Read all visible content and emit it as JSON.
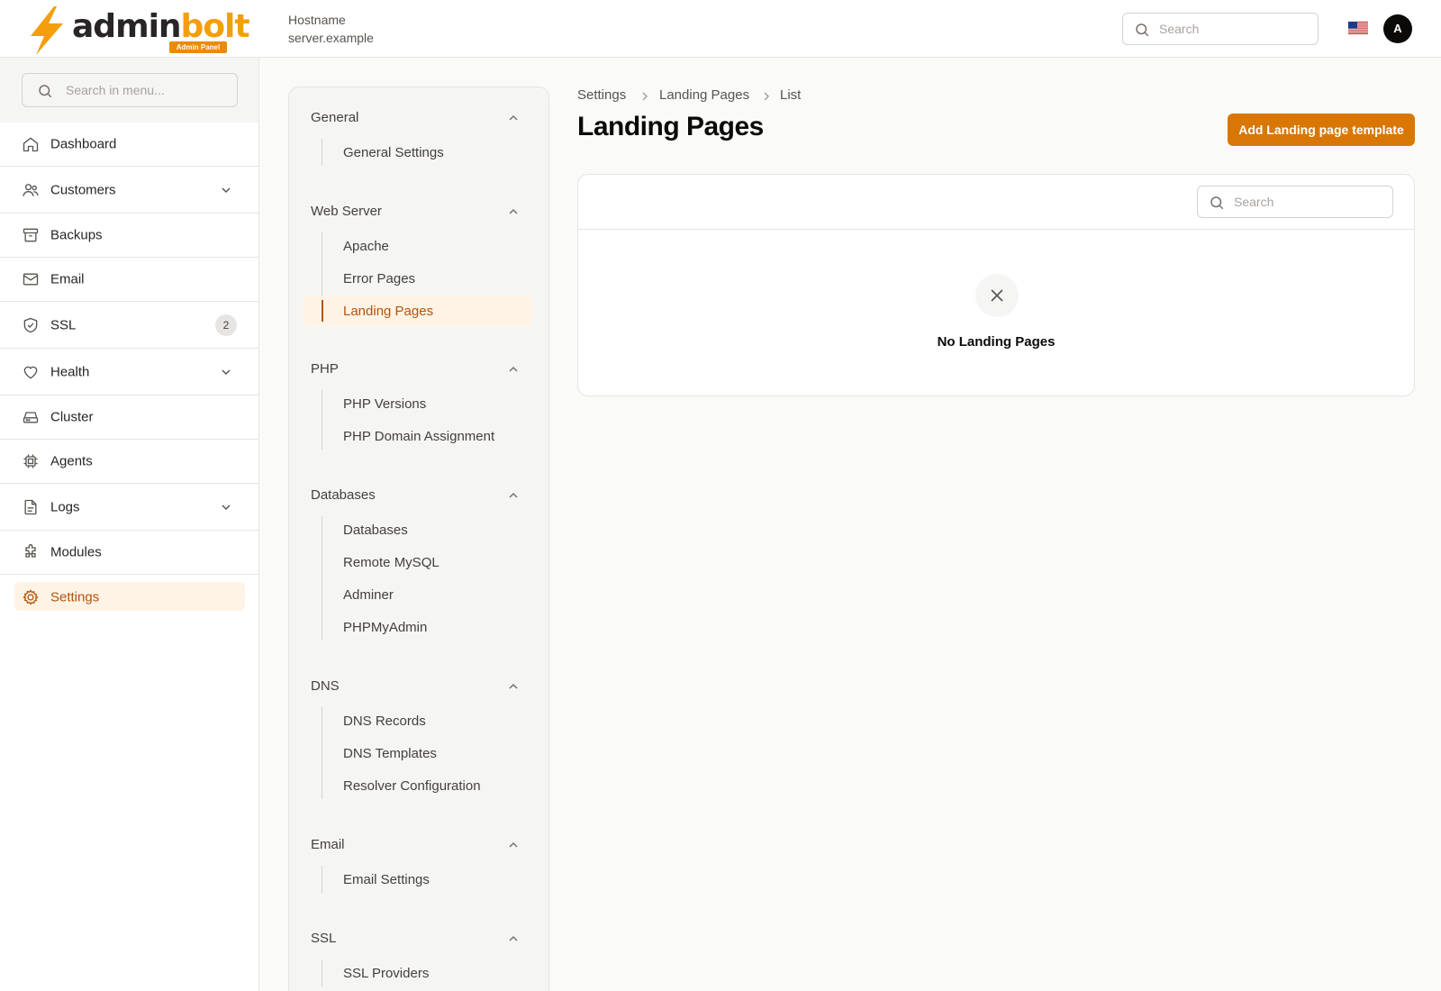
{
  "header": {
    "logo_admin": "admin",
    "logo_bolt": "bolt",
    "logo_badge": "Admin Panel",
    "hostname_label": "Hostname",
    "hostname_value": "server.example",
    "search_placeholder": "Search",
    "avatar_initial": "A"
  },
  "sidebar": {
    "search_placeholder": "Search in menu...",
    "items": [
      {
        "label": "Dashboard",
        "icon": "home-icon"
      },
      {
        "label": "Customers",
        "icon": "users-icon",
        "expandable": true
      },
      {
        "label": "Backups",
        "icon": "archive-icon"
      },
      {
        "label": "Email",
        "icon": "mail-icon"
      },
      {
        "label": "SSL",
        "icon": "shield-icon",
        "badge": "2"
      },
      {
        "label": "Health",
        "icon": "heart-icon",
        "expandable": true
      },
      {
        "label": "Cluster",
        "icon": "server-icon"
      },
      {
        "label": "Agents",
        "icon": "cpu-icon"
      },
      {
        "label": "Logs",
        "icon": "file-icon",
        "expandable": true
      },
      {
        "label": "Modules",
        "icon": "puzzle-icon"
      },
      {
        "label": "Settings",
        "icon": "gear-icon",
        "active": true
      }
    ]
  },
  "settings_nav": {
    "groups": [
      {
        "title": "General",
        "items": [
          "General Settings"
        ]
      },
      {
        "title": "Web Server",
        "items": [
          "Apache",
          "Error Pages",
          "Landing Pages"
        ]
      },
      {
        "title": "PHP",
        "items": [
          "PHP Versions",
          "PHP Domain Assignment"
        ]
      },
      {
        "title": "Databases",
        "items": [
          "Databases",
          "Remote MySQL",
          "Adminer",
          "PHPMyAdmin"
        ]
      },
      {
        "title": "DNS",
        "items": [
          "DNS Records",
          "DNS Templates",
          "Resolver Configuration"
        ]
      },
      {
        "title": "Email",
        "items": [
          "Email Settings"
        ]
      },
      {
        "title": "SSL",
        "items": [
          "SSL Providers"
        ]
      }
    ],
    "active_item": "Landing Pages"
  },
  "main": {
    "breadcrumb": [
      "Settings",
      "Landing Pages",
      "List"
    ],
    "title": "Landing Pages",
    "add_button": "Add Landing page template",
    "table_search_placeholder": "Search",
    "empty_text": "No Landing Pages"
  },
  "colors": {
    "accent": "#d97706",
    "accent_text": "#b45309",
    "active_bg": "#fff3e6"
  }
}
